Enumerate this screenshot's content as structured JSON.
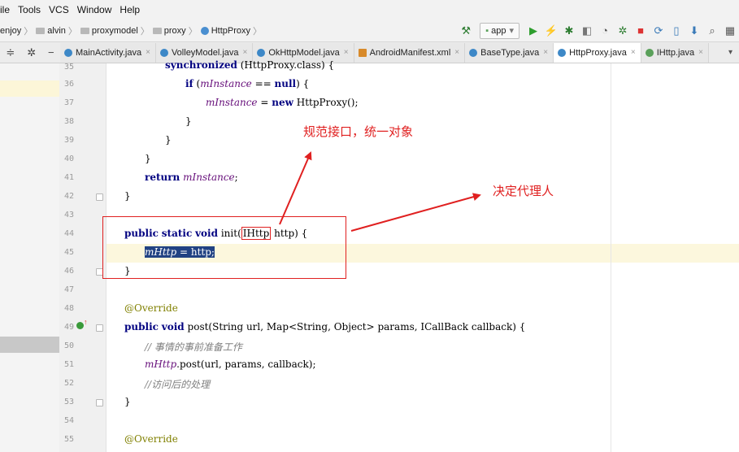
{
  "menubar": {
    "items": [
      "ile",
      "Tools",
      "VCS",
      "Window",
      "Help"
    ]
  },
  "breadcrumb": {
    "items": [
      "enjoy",
      "alvin",
      "proxymodel",
      "proxy",
      "HttpProxy"
    ]
  },
  "toolbar": {
    "run_config": "app"
  },
  "tabs": [
    {
      "label": "MainActivity.java",
      "active": false,
      "icon": "class-icon"
    },
    {
      "label": "VolleyModel.java",
      "active": false,
      "icon": "class-icon"
    },
    {
      "label": "OkHttpModel.java",
      "active": false,
      "icon": "class-icon"
    },
    {
      "label": "AndroidManifest.xml",
      "active": false,
      "icon": "xml-icon"
    },
    {
      "label": "BaseType.java",
      "active": false,
      "icon": "class-icon"
    },
    {
      "label": "HttpProxy.java",
      "active": true,
      "icon": "class-icon"
    },
    {
      "label": "IHttp.java",
      "active": false,
      "icon": "interface-icon"
    }
  ],
  "editor": {
    "line_numbers": [
      "35",
      "36",
      "37",
      "38",
      "39",
      "40",
      "41",
      "42",
      "43",
      "44",
      "45",
      "46",
      "47",
      "48",
      "49",
      "50",
      "51",
      "52",
      "53",
      "54",
      "55"
    ],
    "code": {
      "l35": {
        "kw": "synchronized",
        "rest": " (HttpProxy.class) {"
      },
      "l36": {
        "kw1": "if",
        "p1": " (",
        "fld": "mInstance",
        "p2": " == ",
        "kw2": "null",
        "p3": ") {"
      },
      "l37": {
        "fld": "mInstance",
        "p1": " = ",
        "kw": "new",
        "p2": " HttpProxy();"
      },
      "l38": "}",
      "l39": "}",
      "l40": "}",
      "l41": {
        "kw": "return",
        "fld": "mInstance",
        "p": ";"
      },
      "l42": "}",
      "l44": {
        "kw1": "public",
        "kw2": "static",
        "kw3": "void",
        "m1": "init(",
        "boxed": "IHttp",
        "m2": " http) {"
      },
      "l45": {
        "fld": "mHttp",
        "p": " = http;"
      },
      "l46": "}",
      "l48": "@Override",
      "l49": {
        "kw1": "public",
        "kw2": "void",
        "rest": "post(String url, Map<String, Object> params, ICallBack callback) {"
      },
      "l50": "// 事情的事前准备工作",
      "l51": {
        "fld": "mHttp",
        "p": ".post(url, params, callback);"
      },
      "l52": "//访问后的处理",
      "l53": "}",
      "l55": "@Override"
    }
  },
  "annotations": {
    "note1": "规范接口，统一对象",
    "note2": "决定代理人",
    "color": "#e02020"
  }
}
